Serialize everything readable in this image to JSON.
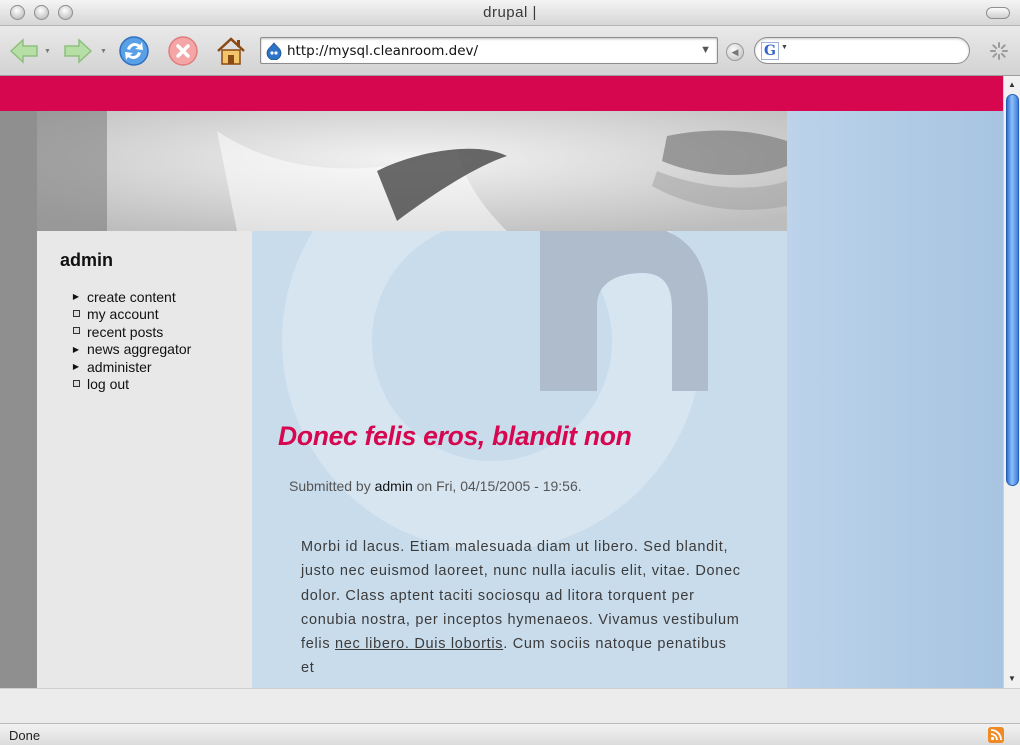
{
  "window": {
    "title": "drupal |"
  },
  "toolbar": {
    "url": "http://mysql.cleanroom.dev/",
    "search_placeholder": ""
  },
  "site": {
    "accent_color": "#d6064f",
    "sidebar": {
      "title": "admin",
      "items": [
        {
          "label": "create content",
          "bullet": "arrow"
        },
        {
          "label": "my account",
          "bullet": "square"
        },
        {
          "label": "recent posts",
          "bullet": "square"
        },
        {
          "label": "news aggregator",
          "bullet": "arrow"
        },
        {
          "label": "administer",
          "bullet": "arrow"
        },
        {
          "label": "log out",
          "bullet": "square"
        }
      ]
    },
    "post": {
      "title": "Donec felis eros, blandit non",
      "submitted_prefix": "Submitted by",
      "author": "admin",
      "submitted_suffix": "on Fri, 04/15/2005 - 19:56.",
      "body_before_link": "Morbi id lacus. Etiam malesuada diam ut libero. Sed blandit, justo nec euismod laoreet, nunc nulla iaculis elit, vitae. Donec dolor. Class aptent taciti sociosqu ad litora torquent per conubia nostra, per inceptos hymenaeos. Vivamus vestibulum felis ",
      "body_link": "nec libero. Duis lobortis",
      "body_after_link": ". Cum sociis natoque penatibus et"
    }
  },
  "statusbar": {
    "text": "Done"
  }
}
